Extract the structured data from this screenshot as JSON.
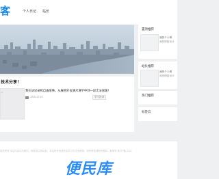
{
  "header": {
    "logo_text": "客",
    "nav": [
      {
        "label": "个人日记"
      },
      {
        "label": "站长"
      }
    ]
  },
  "main": {
    "section_title": "技术分享！",
    "post": {
      "title": "我在站记录和自由故事。从展回外会演术演学中到一段无法离属！",
      "date": "2025-12-19",
      "tag": "学习技术"
    }
  },
  "sidebar": {
    "cards": [
      {
        "title": "置顶推荐",
        "item_line1": "我的个人博",
        "item_line2": "我的博客设计"
      },
      {
        "title": "站长推荐",
        "item_line1": "我的个人博",
        "item_line2": "我的博客设计"
      },
      {
        "title": "热门推荐"
      },
      {
        "title": "标签云"
      }
    ]
  },
  "footer": {
    "copyright": "版权所有 本站内容均为原创，转载请注明出处。本站所有资源仅供学习与交流使用，如有侵权请联系删除。备案号 粤ICP备 2026",
    "watermark": "便民库"
  },
  "colors": {
    "accent": "#1e88e5",
    "watermark": "#2d8cf0",
    "page_bg": "#eef0f2"
  }
}
